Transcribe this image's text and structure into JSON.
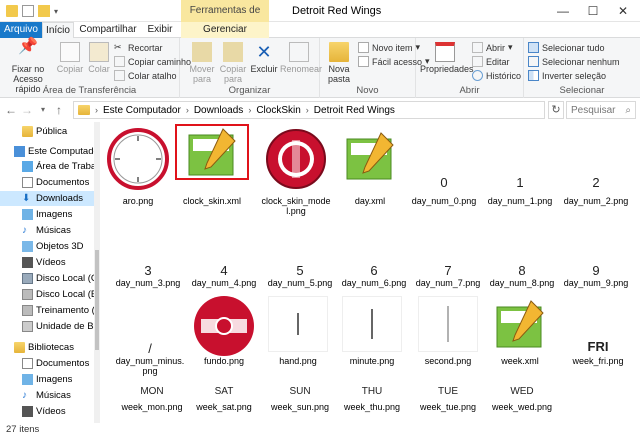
{
  "window": {
    "title": "Detroit Red Wings",
    "context_header": "Ferramentas de Imagem",
    "controls": [
      "—",
      "☐",
      "✕"
    ]
  },
  "tabs": [
    {
      "label": "Arquivo"
    },
    {
      "label": "Início"
    },
    {
      "label": "Compartilhar"
    },
    {
      "label": "Exibir"
    },
    {
      "label": "Gerenciar"
    }
  ],
  "ribbon": {
    "groups": {
      "clipboard": "Área de Transferência",
      "organize": "Organizar",
      "new": "Novo",
      "open": "Abrir",
      "select": "Selecionar"
    },
    "pin": "Fixar no Acesso rápido",
    "copy": "Copiar",
    "paste": "Colar",
    "cut": "Recortar",
    "copy_path": "Copiar caminho",
    "paste_shortcut": "Colar atalho",
    "move_to": "Mover para",
    "copy_to": "Copiar para",
    "delete": "Excluir",
    "rename": "Renomear",
    "new_folder": "Nova pasta",
    "new_item": "Novo item",
    "easy_access": "Fácil acesso",
    "properties": "Propriedades",
    "open": "Abrir",
    "edit": "Editar",
    "history": "Histórico",
    "select_all": "Selecionar tudo",
    "select_none": "Selecionar nenhum",
    "invert_selection": "Inverter seleção"
  },
  "address": {
    "crumbs": [
      "Este Computador",
      "Downloads",
      "ClockSkin",
      "Detroit Red Wings"
    ],
    "search_placeholder": "Pesquisar ..."
  },
  "nav": {
    "items": [
      {
        "label": "Pública"
      },
      {
        "label": "Este Computador"
      },
      {
        "label": "Área de Trabalho"
      },
      {
        "label": "Documentos"
      },
      {
        "label": "Downloads"
      },
      {
        "label": "Imagens"
      },
      {
        "label": "Músicas"
      },
      {
        "label": "Objetos 3D"
      },
      {
        "label": "Vídeos"
      },
      {
        "label": "Disco Local (C:)"
      },
      {
        "label": "Disco Local (E:)"
      },
      {
        "label": "Treinamento (F:)"
      },
      {
        "label": "Unidade de BD-R"
      },
      {
        "label": "Bibliotecas"
      },
      {
        "label": "Documentos"
      },
      {
        "label": "Imagens"
      },
      {
        "label": "Músicas"
      },
      {
        "label": "Vídeos"
      }
    ]
  },
  "files": [
    {
      "name": "aro.png",
      "glyph": ""
    },
    {
      "name": "clock_skin.xml",
      "glyph": ""
    },
    {
      "name": "clock_skin_model.png",
      "glyph": ""
    },
    {
      "name": "day.xml",
      "glyph": ""
    },
    {
      "name": "day_num_0.png",
      "glyph": "0"
    },
    {
      "name": "day_num_1.png",
      "glyph": "1"
    },
    {
      "name": "day_num_2.png",
      "glyph": "2"
    },
    {
      "name": "day_num_3.png",
      "glyph": "3"
    },
    {
      "name": "day_num_4.png",
      "glyph": "4"
    },
    {
      "name": "day_num_5.png",
      "glyph": "5"
    },
    {
      "name": "day_num_6.png",
      "glyph": "6"
    },
    {
      "name": "day_num_7.png",
      "glyph": "7"
    },
    {
      "name": "day_num_8.png",
      "glyph": "8"
    },
    {
      "name": "day_num_9.png",
      "glyph": "9"
    },
    {
      "name": "day_num_minus.png",
      "glyph": "/"
    },
    {
      "name": "fundo.png",
      "glyph": ""
    },
    {
      "name": "hand.png",
      "glyph": ""
    },
    {
      "name": "minute.png",
      "glyph": ""
    },
    {
      "name": "second.png",
      "glyph": ""
    },
    {
      "name": "week.xml",
      "glyph": ""
    },
    {
      "name": "week_fri.png",
      "glyph": "FRI"
    },
    {
      "name": "week_mon.png",
      "glyph": "MON"
    },
    {
      "name": "week_sat.png",
      "glyph": "SAT"
    },
    {
      "name": "week_sun.png",
      "glyph": "SUN"
    },
    {
      "name": "week_thu.png",
      "glyph": "THU"
    },
    {
      "name": "week_tue.png",
      "glyph": "TUE"
    },
    {
      "name": "week_wed.png",
      "glyph": "WED"
    }
  ],
  "status": {
    "count": "27 itens"
  },
  "colors": {
    "file_tab": "#1979ca",
    "selection": "#cce8ff",
    "context_tab": "#f9e79f",
    "highlight_border": "#e0131a"
  }
}
